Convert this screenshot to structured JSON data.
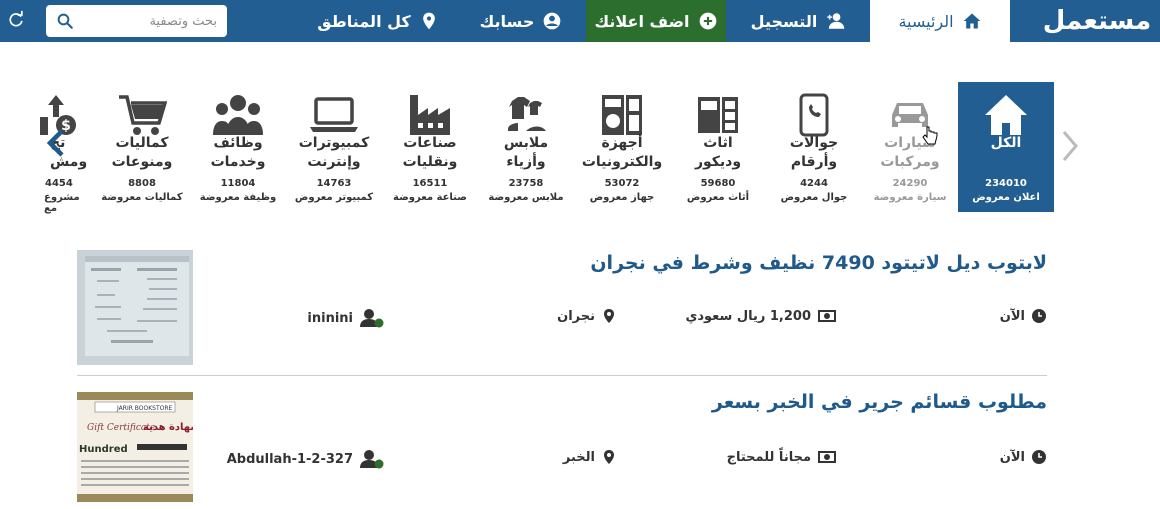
{
  "nav": {
    "logo": "مستعمل",
    "home": "الرئيسية",
    "register": "التسجيل",
    "add_ad": "اضف اعلانك",
    "account": "حسابك",
    "regions": "كل المناطق",
    "search_placeholder": "بحث وتصفية"
  },
  "categories": [
    {
      "name": "الكل",
      "count": "234010",
      "sub": "اعلان معروض",
      "icon": "home-icon"
    },
    {
      "name": "سيارات\nومركبات",
      "count": "24290",
      "sub": "سيارة معروضة",
      "icon": "car-icon"
    },
    {
      "name": "جوالات\nوأرقام",
      "count": "4244",
      "sub": "جوال معروض",
      "icon": "phone-icon"
    },
    {
      "name": "اثاث\nوديكور",
      "count": "59680",
      "sub": "أثاث معروض",
      "icon": "furniture-icon"
    },
    {
      "name": "أجهزة\nوالكترونيات",
      "count": "53072",
      "sub": "جهاز معروض",
      "icon": "appliance-icon"
    },
    {
      "name": "ملابس\nوأزياء",
      "count": "23758",
      "sub": "ملابس معروضة",
      "icon": "clothes-icon"
    },
    {
      "name": "صناعات\nونقليات",
      "count": "16511",
      "sub": "صناعة معروضة",
      "icon": "factory-icon"
    },
    {
      "name": "كمبيوترات\nوإنترنت",
      "count": "14763",
      "sub": "كمبيوتر معروض",
      "icon": "laptop-icon"
    },
    {
      "name": "وظائف\nوخدمات",
      "count": "11804",
      "sub": "وظيفة معروضة",
      "icon": "people-icon"
    },
    {
      "name": "كماليات\nومنوعات",
      "count": "8808",
      "sub": "كماليات معروضة",
      "icon": "cart-icon"
    },
    {
      "name": "تج\nومش",
      "count": "4454",
      "sub": "مشروع مع",
      "icon": "money-icon"
    }
  ],
  "listings": [
    {
      "title": "لابتوب ديل لاتيتود 7490 نظيف وشرط في نجران",
      "time": "الآن",
      "price": "1,200 ريال سعودي",
      "city": "نجران",
      "user": "ininini"
    },
    {
      "title": "مطلوب قسائم جرير في الخبر بسعر",
      "time": "الآن",
      "price": "مجاناً للمحتاج",
      "city": "الخبر",
      "user": "Abdullah-1-2-327"
    }
  ],
  "thumb2": {
    "brand": "JARIR BOOKSTORE",
    "gift": "Gift Certificate",
    "arabic": "شهادة هدية",
    "amount": "Hundred"
  },
  "colors": {
    "nav_blue": "#235e92",
    "add_green": "#2c6e2e",
    "title_blue": "#1f5a8a"
  }
}
